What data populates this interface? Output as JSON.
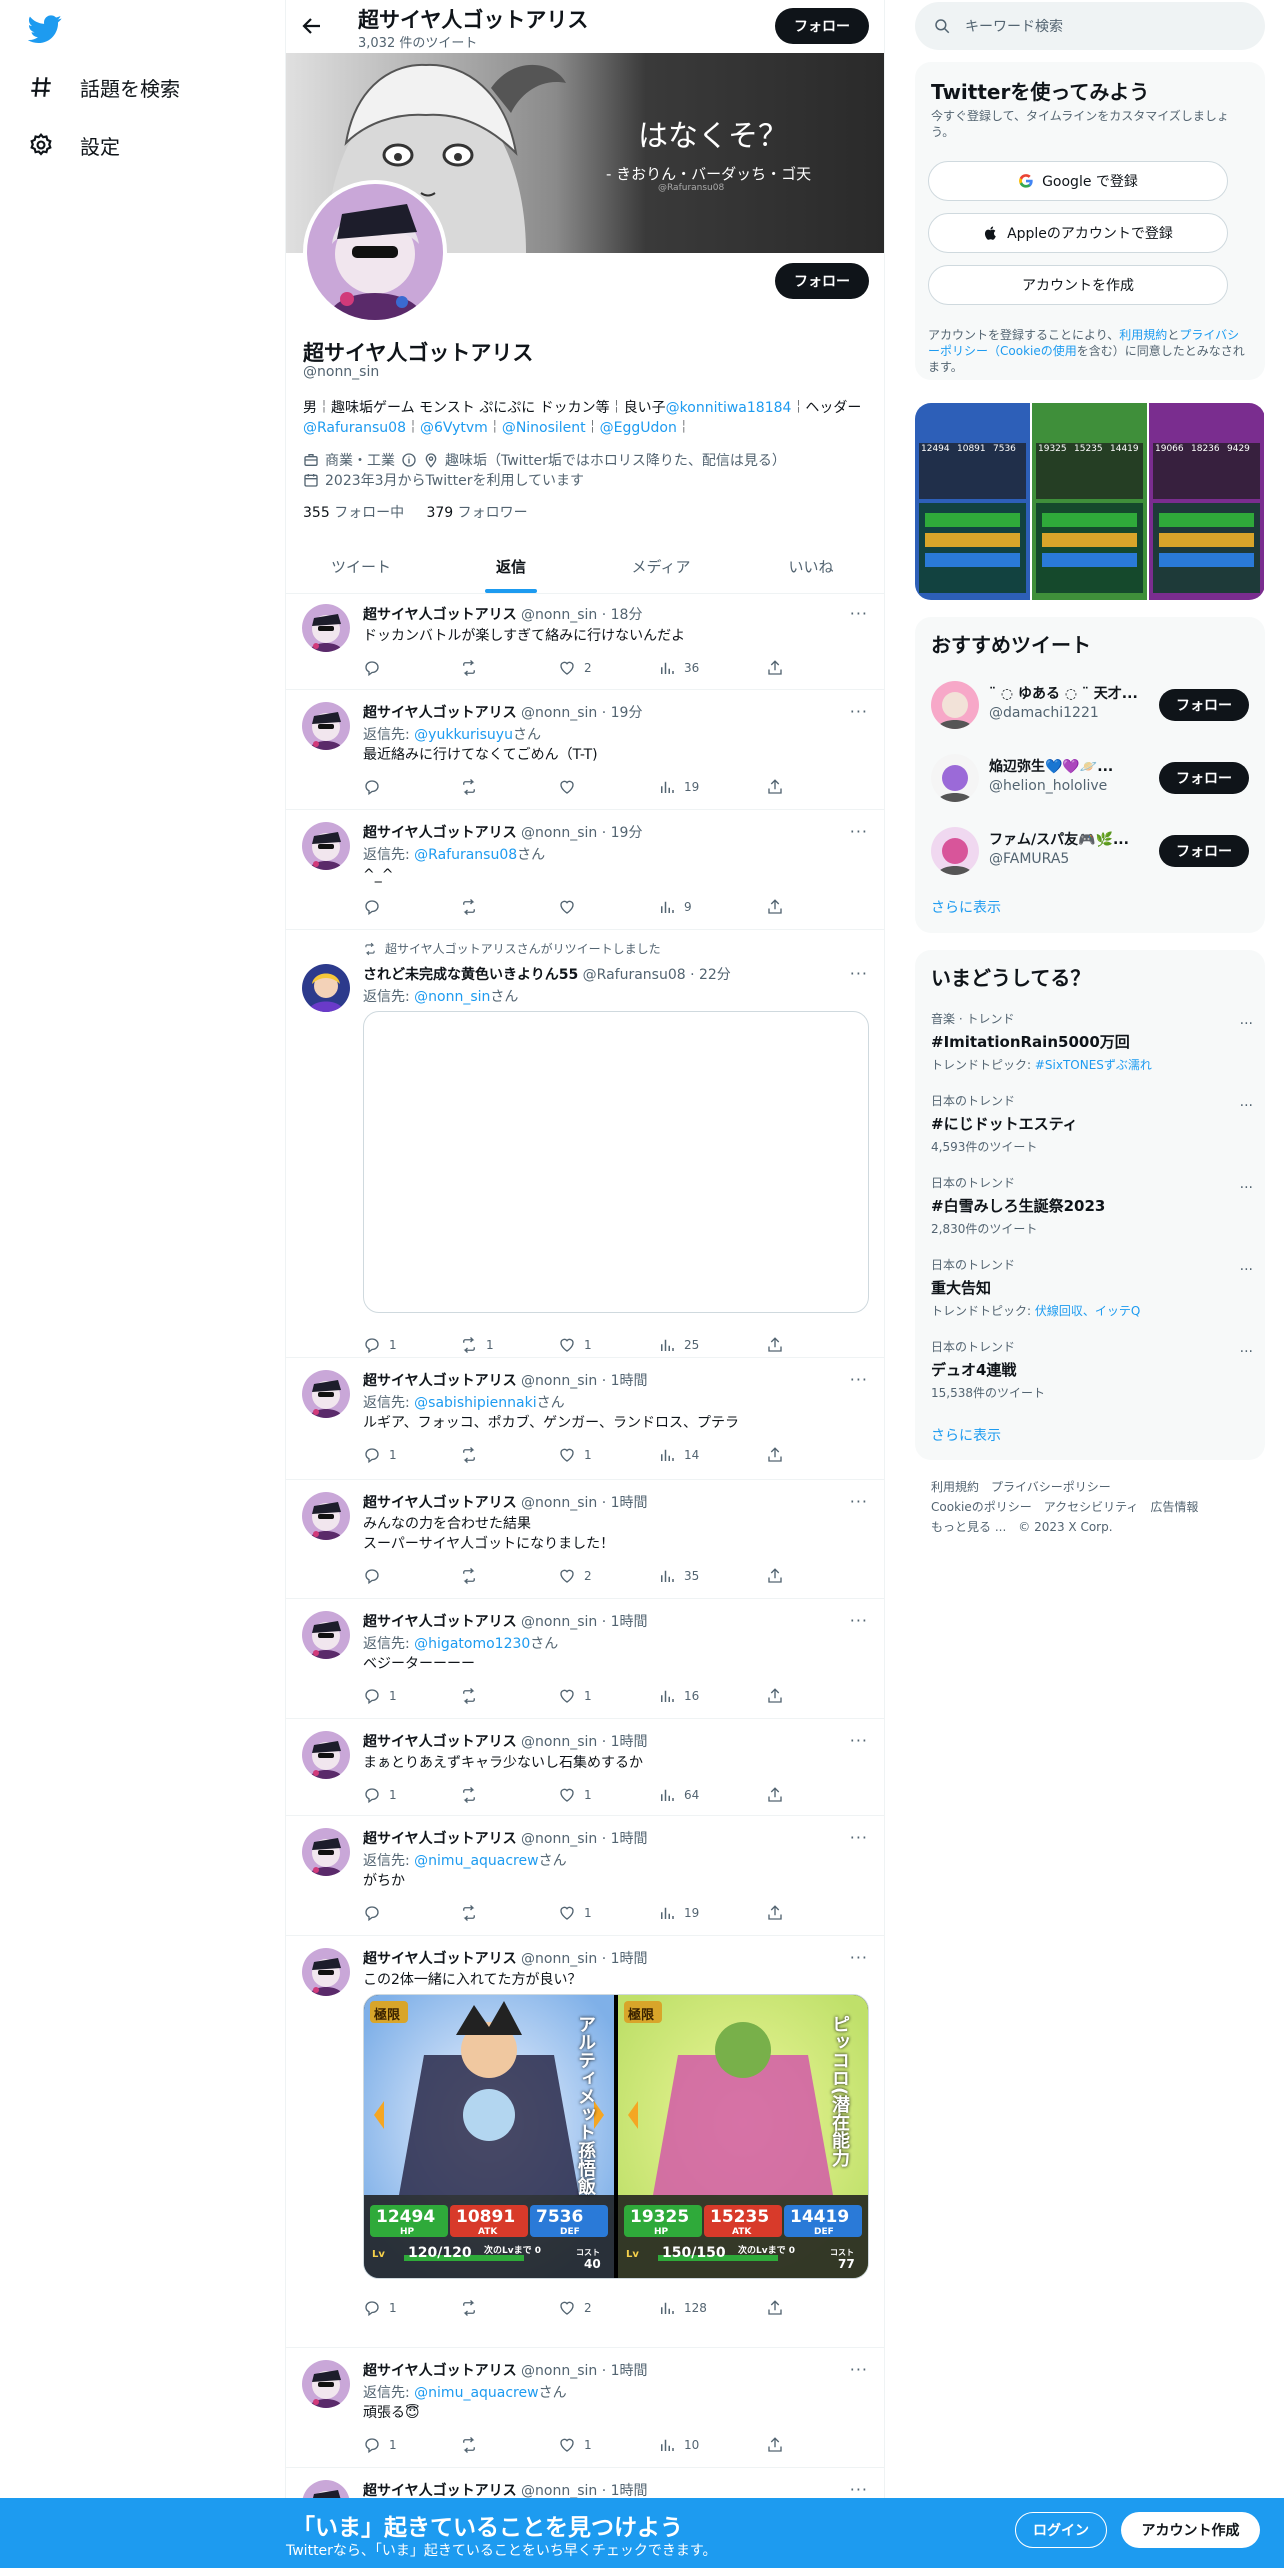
{
  "nav": {
    "explore_label": "話題を検索",
    "settings_label": "設定"
  },
  "header": {
    "name": "超サイヤ人ゴットアリス",
    "tweet_count": "3,032 件のツイート",
    "follow_label": "フォロー"
  },
  "banner": {
    "title": "はなくそ？",
    "subtitle": "- きおりん・バーダッち・ゴ天",
    "credit": "@Rafuransu08"
  },
  "profile": {
    "name": "超サイヤ人ゴットアリス",
    "handle": "@nonn_sin",
    "follow_label": "フォロー",
    "bio_1": "男￤趣味垢ゲーム モンスト ぷにぷに ドッカン等￤良い子",
    "bio_link_1": "@konnitiwa18184",
    "bio_2": "￤ヘッダー",
    "bio_link_2": "@Rafuransu08",
    "bio_sep_1": "￤",
    "bio_link_3": "@6Vytvm",
    "bio_sep_2": "￤",
    "bio_link_4": "@Ninosilent",
    "bio_sep_3": "￤",
    "bio_link_5": "@EggUdon",
    "bio_end": "￤",
    "category": "商業・工業",
    "location": "趣味垢（Twitter垢ではホロリス降りた、配信は見る）",
    "joined": "2023年3月からTwitterを利用しています",
    "following_count": "355",
    "following_label": "フォロー中",
    "followers_count": "379",
    "followers_label": "フォロワー"
  },
  "tabs": [
    {
      "label": "ツイート"
    },
    {
      "label": "返信"
    },
    {
      "label": "メディア"
    },
    {
      "label": "いいね"
    }
  ],
  "tweets": [
    {
      "name": "超サイヤ人ゴットアリス",
      "meta": "@nonn_sin · 18分",
      "reply_to": "",
      "text": "ドッカンバトルが楽しすぎて絡みに行けないんだよ",
      "replies": "",
      "retweets": "",
      "likes": "2",
      "views": "36"
    },
    {
      "name": "超サイヤ人ゴットアリス",
      "meta": "@nonn_sin · 19分",
      "reply_label": "返信先: ",
      "reply_to": "@yukkurisuyu",
      "reply_suffix": "さん",
      "text": "最近絡みに行けてなくてごめん（T-T)",
      "replies": "",
      "retweets": "",
      "likes": "",
      "views": "19"
    },
    {
      "name": "超サイヤ人ゴットアリス",
      "meta": "@nonn_sin · 19分",
      "reply_label": "返信先: ",
      "reply_to": "@Rafuransu08",
      "reply_suffix": "さん",
      "text": "^_^",
      "replies": "",
      "retweets": "",
      "likes": "",
      "views": "9"
    },
    {
      "rt_note": "超サイヤ人ゴットアリスさんがリツイートしました",
      "name": "されど未完成な黄色いきよりん55",
      "meta": "@Rafuransu08 · 22分",
      "reply_label": "返信先: ",
      "reply_to": "@nonn_sin",
      "reply_suffix": "さん",
      "text": "",
      "replies": "1",
      "retweets": "1",
      "likes": "1",
      "views": "25"
    },
    {
      "name": "超サイヤ人ゴットアリス",
      "meta": "@nonn_sin · 1時間",
      "reply_label": "返信先: ",
      "reply_to": "@sabishipiennaki",
      "reply_suffix": "さん",
      "text": "ルギア、フォッコ、ポカブ、ゲンガー、ランドロス、プテラ",
      "replies": "1",
      "retweets": "",
      "likes": "1",
      "views": "14"
    },
    {
      "name": "超サイヤ人ゴットアリス",
      "meta": "@nonn_sin · 1時間",
      "reply_to": "",
      "text": "みんなの力を合わせた結果\nスーパーサイヤ人ゴットになりました！",
      "replies": "",
      "retweets": "",
      "likes": "2",
      "views": "35"
    },
    {
      "name": "超サイヤ人ゴットアリス",
      "meta": "@nonn_sin · 1時間",
      "reply_label": "返信先: ",
      "reply_to": "@higatomo1230",
      "reply_suffix": "さん",
      "text": "ベジーターーーー",
      "replies": "1",
      "retweets": "",
      "likes": "1",
      "views": "16"
    },
    {
      "name": "超サイヤ人ゴットアリス",
      "meta": "@nonn_sin · 1時間",
      "reply_to": "",
      "text": "まぁとりあえずキャラ少ないし石集めするか",
      "replies": "1",
      "retweets": "",
      "likes": "1",
      "views": "64"
    },
    {
      "name": "超サイヤ人ゴットアリス",
      "meta": "@nonn_sin · 1時間",
      "reply_label": "返信先: ",
      "reply_to": "@nimu_aquacrew",
      "reply_suffix": "さん",
      "text": "がちか",
      "replies": "",
      "retweets": "",
      "likes": "1",
      "views": "19"
    },
    {
      "name": "超サイヤ人ゴットアリス",
      "meta": "@nonn_sin · 1時間",
      "reply_to": "",
      "text": "この2体一緒に入れてた方が良い？",
      "replies": "1",
      "retweets": "",
      "likes": "2",
      "views": "128"
    },
    {
      "name": "超サイヤ人ゴットアリス",
      "meta": "@nonn_sin · 1時間",
      "reply_label": "返信先: ",
      "reply_to": "@nimu_aquacrew",
      "reply_suffix": "さん",
      "text": "頑張る😇",
      "replies": "1",
      "retweets": "",
      "likes": "1",
      "views": "10"
    },
    {
      "name": "超サイヤ人ゴットアリス",
      "meta": "@nonn_sin · 1時間",
      "reply_to": "",
      "text": ""
    }
  ],
  "cards": {
    "left": {
      "badge": "極限",
      "hp": "12494",
      "atk": "10891",
      "def": "7536",
      "hp_label": "HP",
      "atk_label": "ATK",
      "def_label": "DEF",
      "level": "120/120",
      "cost": "40",
      "level_label": "Lv",
      "cost_label": "コスト",
      "next_label": "次のLvまで 0",
      "side_text": "アルティメット孫悟飯"
    },
    "right": {
      "badge": "極限",
      "hp": "19325",
      "atk": "15235",
      "def": "14419",
      "hp_label": "HP",
      "atk_label": "ATK",
      "def_label": "DEF",
      "level": "150/150",
      "cost": "77",
      "level_label": "Lv",
      "cost_label": "コスト",
      "next_label": "次のLvまで 0",
      "side_text": "ピッコロ(潜在能力"
    }
  },
  "search": {
    "placeholder": "キーワード検索"
  },
  "signup": {
    "title": "Twitterを使ってみよう",
    "subtitle": "今すぐ登録して、タイムラインをカスタマイズしましょう。",
    "google": "Google で登録",
    "apple": "Appleのアカウントで登録",
    "create": "アカウントを作成",
    "terms_1": "アカウントを登録することにより、",
    "terms_link_1": "利用規約",
    "terms_2": "と",
    "terms_link_2": "プライバシーポリシー（Cookieの使用",
    "terms_3": "を含む）に同意したとみなされます。"
  },
  "gallery": {
    "stats": [
      "12494",
      "10891",
      "7536",
      "19325",
      "15235",
      "14419",
      "19066",
      "18236",
      "9429"
    ]
  },
  "recommend": {
    "title": "おすすめツイート",
    "items": [
      {
        "name": "¨ ◌ ゆある ◌ ¨ 天才...",
        "handle": "@damachi1221",
        "follow": "フォロー"
      },
      {
        "name": "焔辺弥生💙💜🪐...",
        "handle": "@helion_hololive",
        "follow": "フォロー"
      },
      {
        "name": "ファム/スパ友🎮🌿...",
        "handle": "@FAMURA5",
        "follow": "フォロー"
      }
    ],
    "show_more": "さらに表示"
  },
  "trends": {
    "title": "いまどうしてる？",
    "items": [
      {
        "category": "音楽 · トレンド",
        "name": "#ImitationRain5000万回",
        "sub_label": "トレンドトピック: ",
        "sub_link": "#SixTONESずぶ濡れ",
        "sub": ""
      },
      {
        "category": "日本のトレンド",
        "name": "#にじドットエスティ",
        "sub_label": "",
        "sub_link": "",
        "sub": "4,593件のツイート"
      },
      {
        "category": "日本のトレンド",
        "name": "#白雪みしろ生誕祭2023",
        "sub_label": "",
        "sub_link": "",
        "sub": "2,830件のツイート"
      },
      {
        "category": "日本のトレンド",
        "name": "重大告知",
        "sub_label": "トレンドトピック: ",
        "sub_link": "伏線回収、イッテQ",
        "sub": ""
      },
      {
        "category": "日本のトレンド",
        "name": "デュオ4連戦",
        "sub_label": "",
        "sub_link": "",
        "sub": "15,538件のツイート"
      }
    ],
    "show_more": "さらに表示"
  },
  "footer": {
    "line1": "利用規約　プライバシーポリシー",
    "line2": "Cookieのポリシー　アクセシビリティ　広告情報",
    "line3": "もっと見る ...　© 2023 X Corp."
  },
  "bottom": {
    "title": "「いま」起きていることを見つけよう",
    "subtitle": "Twitterなら、「いま」起きていることをいち早くチェックできます。",
    "login": "ログイン",
    "create": "アカウント作成"
  },
  "colors": {
    "accent": "#1d9bf0",
    "bottom_bar": "#1d9bf0",
    "text": "#0f1419",
    "muted": "#536471"
  }
}
